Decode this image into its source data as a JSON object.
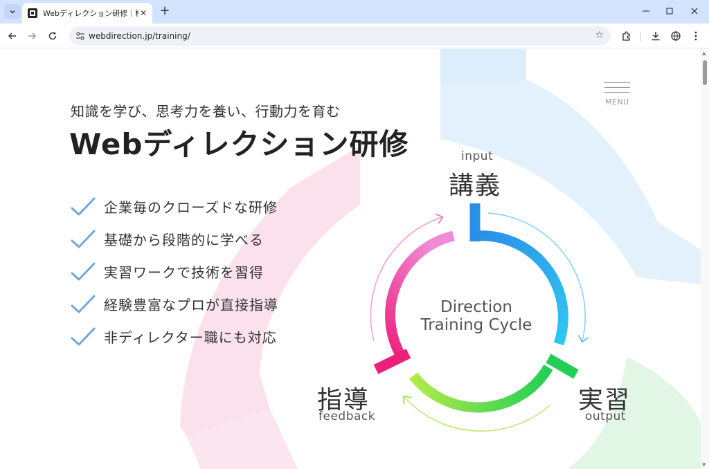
{
  "browser": {
    "tab_title": "Webディレクション研修｜株式会社",
    "url": "webdirection.jp/training/"
  },
  "page": {
    "menu_label": "MENU",
    "subtitle": "知識を学び、思考力を養い、行動力を育む",
    "title": "Webディレクション研修",
    "features": [
      "企業毎のクローズドな研修",
      "基礎から段階的に学べる",
      "実習ワークで技術を習得",
      "経験豊富なプロが直接指導",
      "非ディレクター職にも対応"
    ],
    "cycle": {
      "center_line1": "Direction",
      "center_line2": "Training Cycle",
      "input": {
        "label": "講義",
        "sub": "input"
      },
      "output": {
        "label": "実習",
        "sub": "output"
      },
      "feedback": {
        "label": "指導",
        "sub": "feedback"
      }
    }
  },
  "colors": {
    "input": "#2f9be8",
    "output": "#2fd35a",
    "feedback": "#ec2c85",
    "check": "#6fa8dc"
  }
}
